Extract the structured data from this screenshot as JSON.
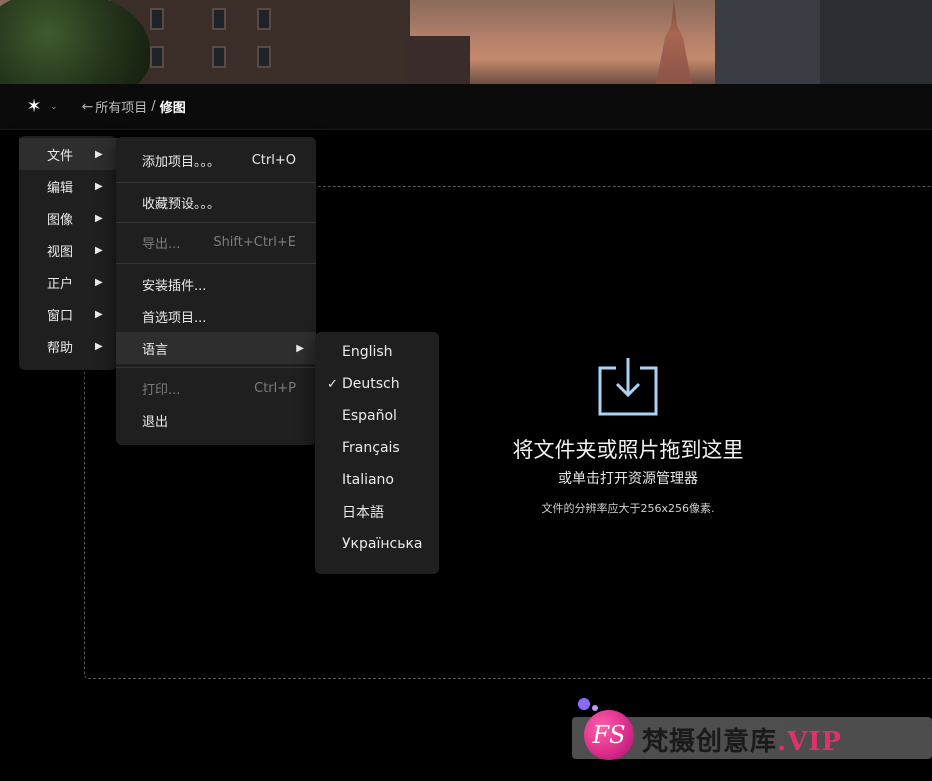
{
  "header": {
    "logo_glyph": "✶",
    "caret_glyph": "⌄",
    "back_glyph": "←",
    "breadcrumb_root": "所有项目",
    "breadcrumb_sep": "/",
    "breadcrumb_current": "修图"
  },
  "main_menu": {
    "items": [
      {
        "label": "文件"
      },
      {
        "label": "编辑"
      },
      {
        "label": "图像"
      },
      {
        "label": "视图"
      },
      {
        "label": "正户"
      },
      {
        "label": "窗口"
      },
      {
        "label": "帮助"
      }
    ]
  },
  "file_menu": {
    "items": [
      {
        "label": "添加项目。。。",
        "shortcut": "Ctrl+O"
      },
      {
        "label": "收藏预设。。。",
        "shortcut": ""
      },
      {
        "label": "导出...",
        "shortcut": "Shift+Ctrl+E"
      },
      {
        "label": "安装插件...",
        "shortcut": ""
      },
      {
        "label": "首选项目...",
        "shortcut": ""
      },
      {
        "label": "语言",
        "shortcut": ""
      },
      {
        "label": "打印...",
        "shortcut": "Ctrl+P"
      },
      {
        "label": "退出",
        "shortcut": ""
      }
    ]
  },
  "language_menu": {
    "items": [
      {
        "label": "English"
      },
      {
        "label": "Deutsch"
      },
      {
        "label": "Español"
      },
      {
        "label": "Français"
      },
      {
        "label": "Italiano"
      },
      {
        "label": "日本語"
      },
      {
        "label": "Українська"
      }
    ],
    "checked_glyph": "✓"
  },
  "dropzone": {
    "title": "将文件夹或照片拖到这里",
    "subtitle": "或单击打开资源管理器",
    "note": "文件的分辨率应大于256x256像素."
  },
  "watermark": {
    "logo_text": "FS",
    "text": "梵摄创意库",
    "suffix": ".VIP"
  },
  "colors": {
    "background": "#000000",
    "menu_bg": "#1f1f1f",
    "menu_active": "#2e2e2e",
    "icon_blue": "#a9d4f5"
  }
}
